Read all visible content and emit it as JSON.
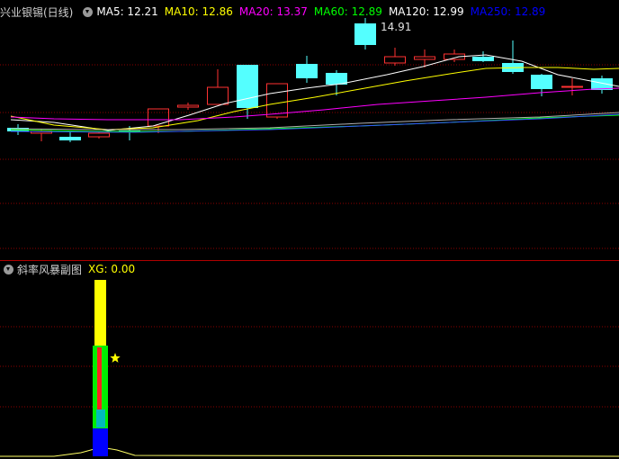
{
  "main_panel": {
    "stock_title": "兴业银锡(日线)",
    "indicators": [
      {
        "label": "MA5: 12.21",
        "color": "#ffffff"
      },
      {
        "label": "MA10: 12.86",
        "color": "#ffff00"
      },
      {
        "label": "MA20: 13.37",
        "color": "#ff00ff"
      },
      {
        "label": "MA60: 12.89",
        "color": "#00ff00"
      },
      {
        "label": "MA120: 12.99",
        "color": "#ffffff"
      },
      {
        "label": "MA250: 12.89",
        "color": "#0000ff"
      }
    ],
    "high_price_label": "14.91"
  },
  "sub_panel": {
    "title": "斜率风暴副图",
    "xg_label": "XG: 0.00",
    "xg_color": "#ffff00",
    "star_icon": "star-icon"
  },
  "colors": {
    "up_candle": "#ff3232",
    "down_candle": "#54ffff",
    "grid": "#8b0000",
    "divider": "#b00000"
  }
}
